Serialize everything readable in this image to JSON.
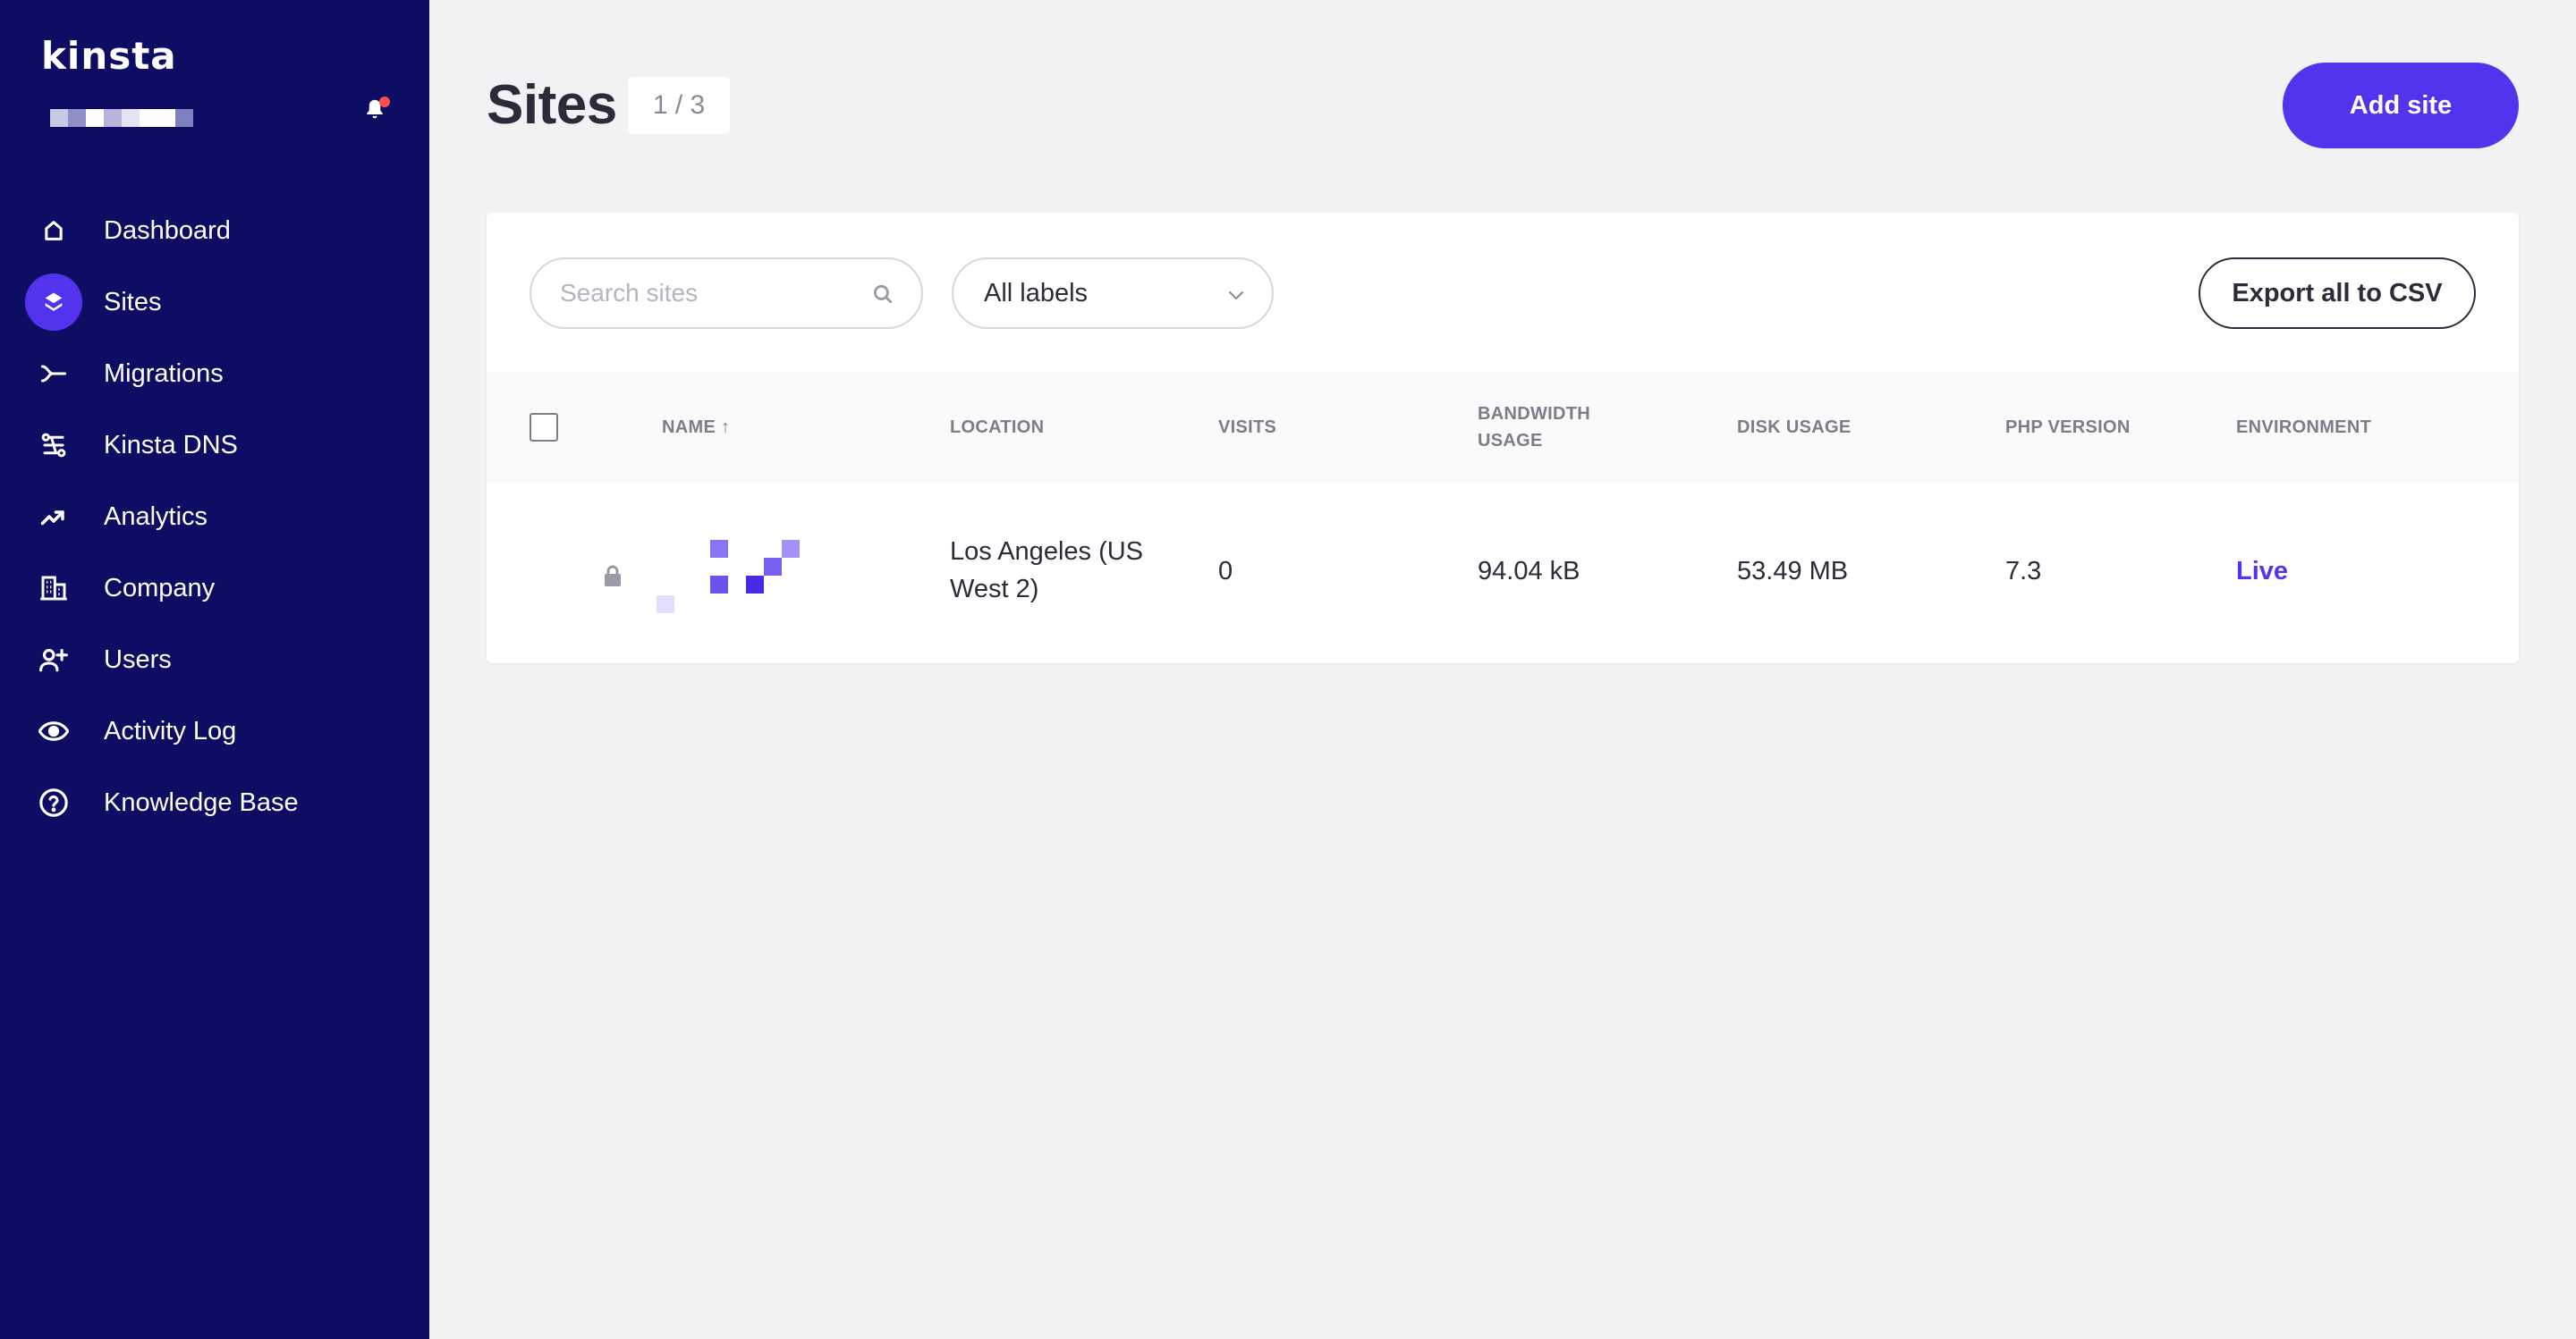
{
  "app": {
    "logo": "kinsta",
    "account_name": ""
  },
  "colors": {
    "sidebar_bg": "#0e0d64",
    "accent": "#5333ed",
    "notification": "#ff4d4d"
  },
  "sidebar": {
    "items": [
      {
        "label": "Dashboard",
        "icon": "home-icon",
        "active": false
      },
      {
        "label": "Sites",
        "icon": "layers-icon",
        "active": true
      },
      {
        "label": "Migrations",
        "icon": "migrations-icon",
        "active": false
      },
      {
        "label": "Kinsta DNS",
        "icon": "dns-icon",
        "active": false
      },
      {
        "label": "Analytics",
        "icon": "trending-up-icon",
        "active": false
      },
      {
        "label": "Company",
        "icon": "building-icon",
        "active": false
      },
      {
        "label": "Users",
        "icon": "user-plus-icon",
        "active": false
      },
      {
        "label": "Activity Log",
        "icon": "eye-icon",
        "active": false
      },
      {
        "label": "Knowledge Base",
        "icon": "help-circle-icon",
        "active": false
      }
    ]
  },
  "header": {
    "title": "Sites",
    "counter": "1 / 3",
    "add_button": "Add site"
  },
  "toolbar": {
    "search_placeholder": "Search sites",
    "search_value": "",
    "labels_selected": "All labels",
    "export_button": "Export all to CSV"
  },
  "table": {
    "columns": {
      "name": "NAME ↑",
      "location": "LOCATION",
      "visits": "VISITS",
      "bandwidth_line1": "BANDWIDTH",
      "bandwidth_line2": "USAGE",
      "disk": "DISK USAGE",
      "php": "PHP VERSION",
      "environment": "ENVIRONMENT"
    },
    "rows": [
      {
        "name": "",
        "location_line1": "Los Angeles (US",
        "location_line2": "West 2)",
        "visits": "0",
        "bandwidth": "94.04 kB",
        "disk": "53.49 MB",
        "php": "7.3",
        "environment": "Live"
      }
    ]
  }
}
